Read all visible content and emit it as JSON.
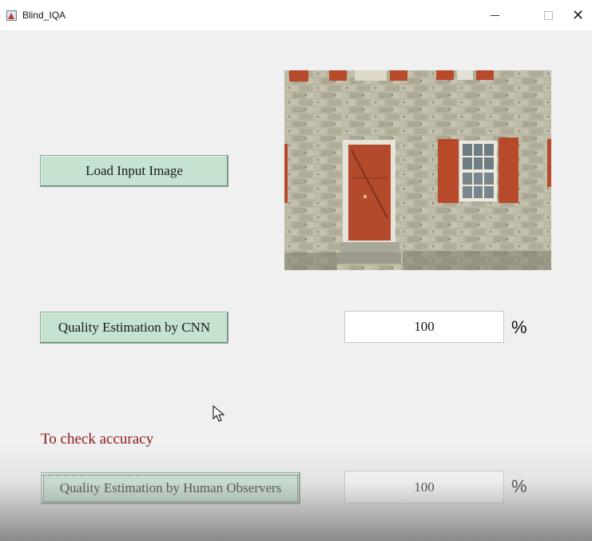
{
  "window": {
    "title": "Blind_IQA"
  },
  "buttons": {
    "load": "Load Input Image",
    "cnn": "Quality Estimation by CNN",
    "human": "Quality Estimation by Human Observers"
  },
  "fields": {
    "cnn_value": "100",
    "human_value": "100",
    "unit": "%"
  },
  "labels": {
    "accuracy": "To check accuracy"
  },
  "colors": {
    "button_bg": "#c5e3d0",
    "label_red": "#8b1a1a",
    "door_red": "#b84a2c",
    "wall_stone": "#b9b8a6"
  }
}
